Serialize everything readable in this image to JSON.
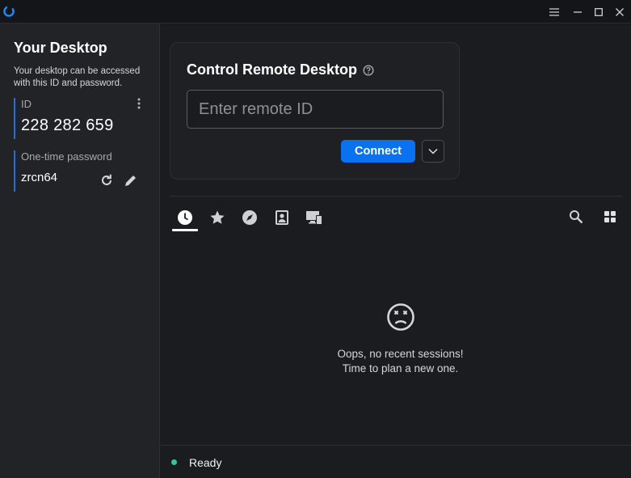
{
  "window": {
    "menu_icon": "hamburger-icon",
    "minimize_icon": "minimize-icon",
    "maximize_icon": "maximize-icon",
    "close_icon": "close-icon"
  },
  "sidebar": {
    "title": "Your Desktop",
    "description": "Your desktop can be accessed with this ID and password.",
    "id_label": "ID",
    "id_value": "228 282 659",
    "password_label": "One-time password",
    "password_value": "zrcn64"
  },
  "control": {
    "title": "Control Remote Desktop",
    "input_placeholder": "Enter remote ID",
    "input_value": "",
    "connect_label": "Connect"
  },
  "tabs": [
    {
      "name": "recent-sessions",
      "icon": "clock-icon",
      "active": true
    },
    {
      "name": "favorites",
      "icon": "star-icon",
      "active": false
    },
    {
      "name": "discovered",
      "icon": "compass-icon",
      "active": false
    },
    {
      "name": "address-book",
      "icon": "contact-icon",
      "active": false
    },
    {
      "name": "devices",
      "icon": "devices-icon",
      "active": false
    }
  ],
  "empty_state": {
    "line1": "Oops, no recent sessions!",
    "line2": "Time to plan a new one."
  },
  "status": {
    "text": "Ready",
    "color": "#3ac2a0"
  },
  "colors": {
    "accent": "#0a72f0",
    "id_bar": "#1e6fe0"
  }
}
